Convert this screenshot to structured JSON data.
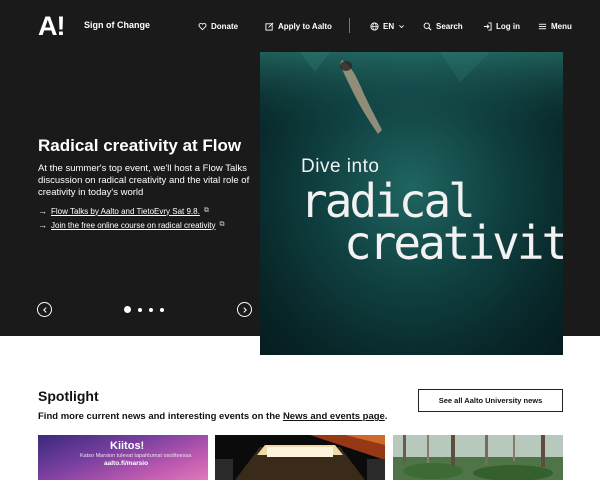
{
  "header": {
    "logo": "A!",
    "site_name": "Sign of Change",
    "nav": {
      "donate": "Donate",
      "apply": "Apply to Aalto",
      "language": "EN",
      "search": "Search",
      "login": "Log in",
      "menu": "Menu"
    }
  },
  "hero": {
    "title": "Radical creativity at Flow",
    "description": "At the summer's top event, we'll host a Flow Talks discussion on radical creativity and the vital role of creativity in today's world",
    "links": [
      "Flow Talks by Aalto and TietoEvry Sat 9.8.",
      "Join the free online course on radical creativity"
    ],
    "carousel": {
      "slides": 4,
      "active": 1
    },
    "image_text": {
      "line1": "Dive into",
      "line2": "radical",
      "line3": "creativity"
    }
  },
  "spotlight": {
    "title": "Spotlight",
    "subtitle_prefix": "Find more current news and interesting events on the ",
    "subtitle_link": "News and events page",
    "subtitle_suffix": ".",
    "see_all": "See all Aalto University news",
    "card1": {
      "title": "Kiitos!",
      "subtitle": "Katso Marsion tulevat tapahtumat osoitteessa",
      "url": "aalto.fi/marsio"
    }
  },
  "colors": {
    "hero_bg": "#1a1a1a",
    "image_bg": "#0f3e3f",
    "text_light": "#ffffff"
  },
  "icons": [
    "heart-icon",
    "pen-square-icon",
    "globe-icon",
    "chevron-down-icon",
    "search-icon",
    "login-icon",
    "menu-icon",
    "arrow-right-icon",
    "external-link-icon",
    "chevron-left-icon",
    "chevron-right-icon"
  ]
}
